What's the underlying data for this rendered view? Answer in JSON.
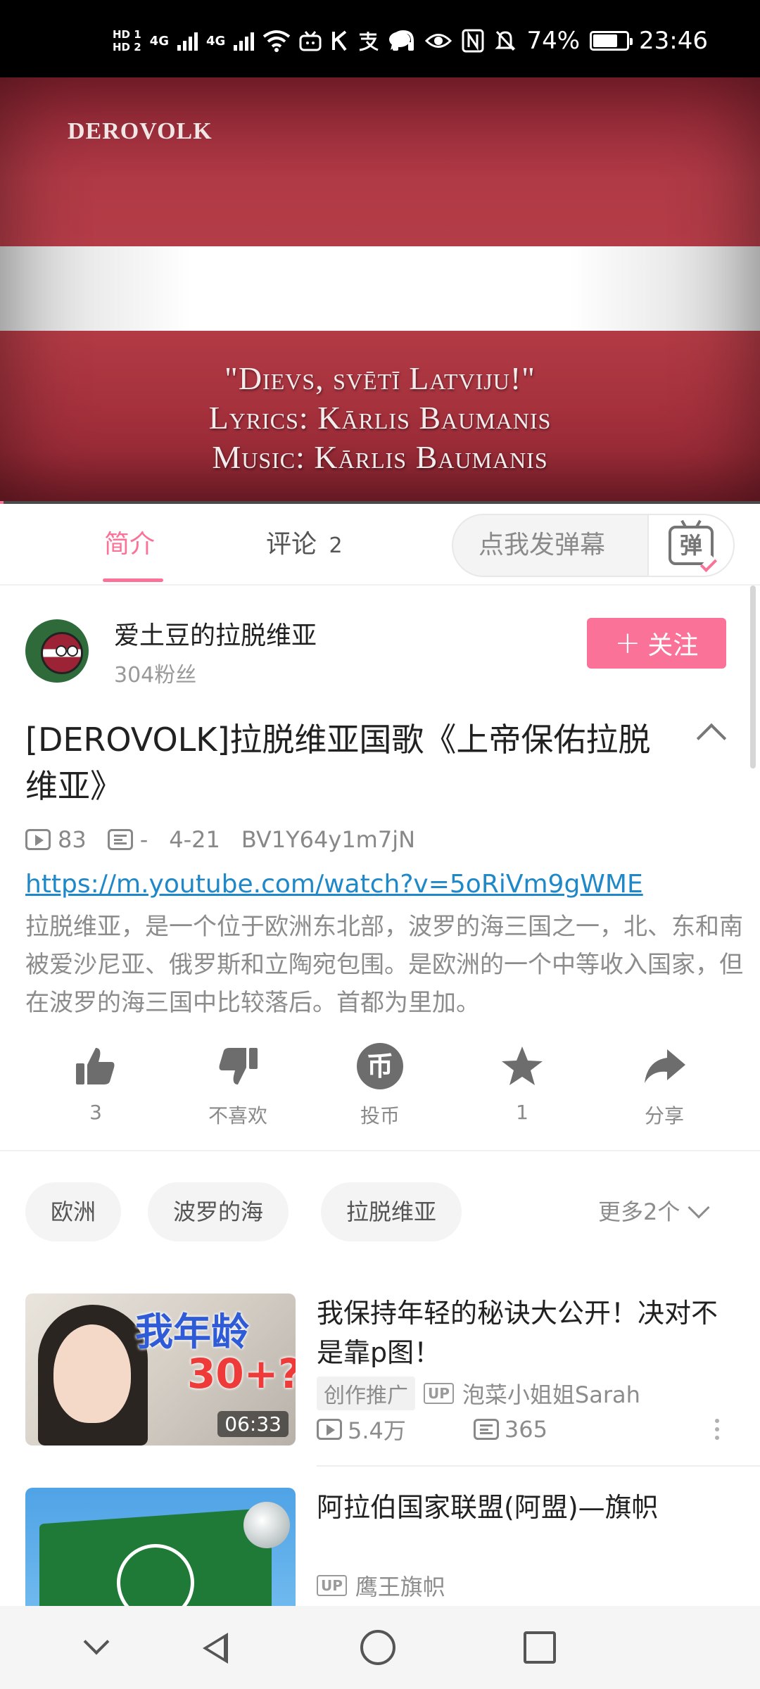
{
  "status_bar": {
    "hd1": "HD 1",
    "hd2": "HD 2",
    "network1": "4G",
    "network2": "4G",
    "battery_text": "74%",
    "battery_level": 0.74,
    "time": "23:46",
    "icons": [
      "signal-icon",
      "wifi-icon",
      "tv-icon",
      "k-icon",
      "alipay-icon",
      "message-icon",
      "headphones-icon",
      "eye-icon",
      "nfc-icon",
      "mute-icon",
      "battery-icon"
    ]
  },
  "video": {
    "logo": "DEROVOLK",
    "line1": "\"Dievs, svētī Latviju!\"",
    "line2": "Lyrics: Kārlis Baumanis",
    "line3": "Music: Kārlis Baumanis",
    "progress_fraction": 0.005,
    "colors": {
      "flag_red": "#a52e3b",
      "progress": "#fb7299"
    }
  },
  "tabs": {
    "intro": "简介",
    "comments": "评论",
    "comment_count": "2",
    "danmu_placeholder": "点我发弹幕",
    "danmu_icon_char": "弹"
  },
  "uploader": {
    "name": "爱土豆的拉脱维亚",
    "fans": "304粉丝",
    "follow_label": "关注",
    "follow_plus": "+"
  },
  "video_info": {
    "title": "[DEROVOLK]拉脱维亚国歌《上帝保佑拉脱维亚》",
    "views": "83",
    "danmaku": "-",
    "date": "4-21",
    "bvid": "BV1Y64y1m7jN",
    "link": "https://m.youtube.com/watch?v=5oRiVm9gWME",
    "description": "拉脱维亚，是一个位于欧洲东北部，波罗的海三国之一，北、东和南被爱沙尼亚、俄罗斯和立陶宛包围。是欧洲的一个中等收入国家，但在波罗的海三国中比较落后。首都为里加。"
  },
  "actions": {
    "like_count": "3",
    "dislike_label": "不喜欢",
    "coin_label": "投币",
    "coin_char": "币",
    "favorite_count": "1",
    "share_label": "分享"
  },
  "tags": {
    "items": [
      "欧洲",
      "波罗的海",
      "拉脱维亚"
    ],
    "more": "更多2个"
  },
  "recommendations": [
    {
      "title": "我保持年轻的秘诀大公开！决对不是靠p图！",
      "thumb_text1": "我年龄",
      "thumb_text2": "30+?",
      "duration": "06:33",
      "promo": "创作推广",
      "up_badge": "UP",
      "uploader": "泡菜小姐姐Sarah",
      "views": "5.4万",
      "danmaku": "365"
    },
    {
      "title": "阿拉伯国家联盟(阿盟)—旗帜",
      "up_badge": "UP",
      "uploader": "鹰王旗帜"
    }
  ]
}
